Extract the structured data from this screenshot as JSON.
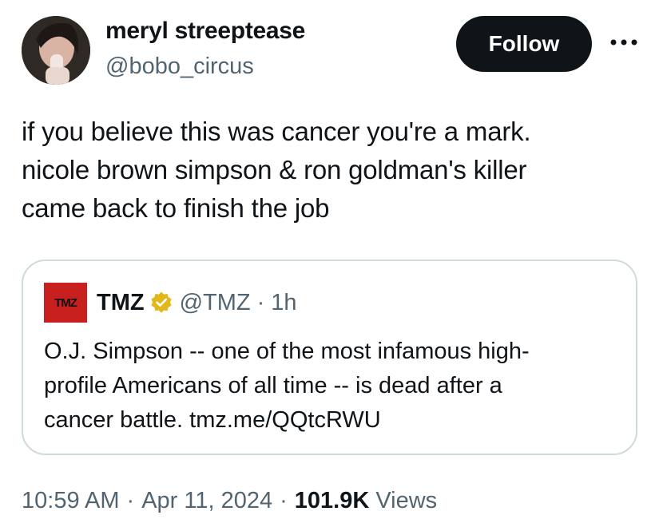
{
  "author": {
    "display_name": "meryl streeptease",
    "handle": "@bobo_circus"
  },
  "actions": {
    "follow_label": "Follow",
    "more_icon": "more-horizontal-icon"
  },
  "tweet": {
    "text_lines": [
      "if you believe this was cancer you're a mark.",
      "nicole brown simpson & ron goldman's killer",
      "came back to finish the job"
    ]
  },
  "quote": {
    "logo_text": "TMZ",
    "display_name": "TMZ",
    "verified_icon": "verified-badge-icon",
    "handle": "@TMZ",
    "separator": "·",
    "time": "1h",
    "text_lines": [
      "O.J. Simpson -- one of the most infamous high-",
      "profile Americans of all time -- is dead after a",
      "cancer battle. tmz.me/QQtcRWU"
    ]
  },
  "meta": {
    "time": "10:59 AM",
    "separator": "·",
    "date": "Apr 11, 2024",
    "views_count": "101.9K",
    "views_label": "Views"
  },
  "colors": {
    "text": "#0f1419",
    "secondary": "#536471",
    "border": "#cfd9de",
    "follow_bg": "#0f1419",
    "tmz_red": "#c8201f",
    "verified_gold": "#e2b719"
  }
}
